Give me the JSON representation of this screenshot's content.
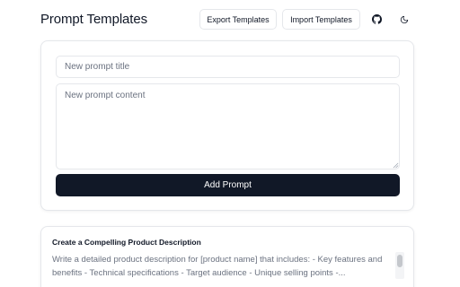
{
  "header": {
    "title": "Prompt Templates",
    "export_label": "Export Templates",
    "import_label": "Import Templates",
    "github_icon": "github-icon",
    "theme_icon": "moon-icon"
  },
  "form": {
    "title_placeholder": "New prompt title",
    "content_placeholder": "New prompt content",
    "add_label": "Add Prompt"
  },
  "prompts": [
    {
      "title": "Create a Compelling Product Description",
      "content": "Write a detailed product description for [product name] that includes: - Key features and benefits - Technical specifications - Target audience - Unique selling points -..."
    }
  ],
  "colors": {
    "primary": "#111827",
    "border": "#e5e7eb",
    "muted_text": "#6b7280"
  }
}
